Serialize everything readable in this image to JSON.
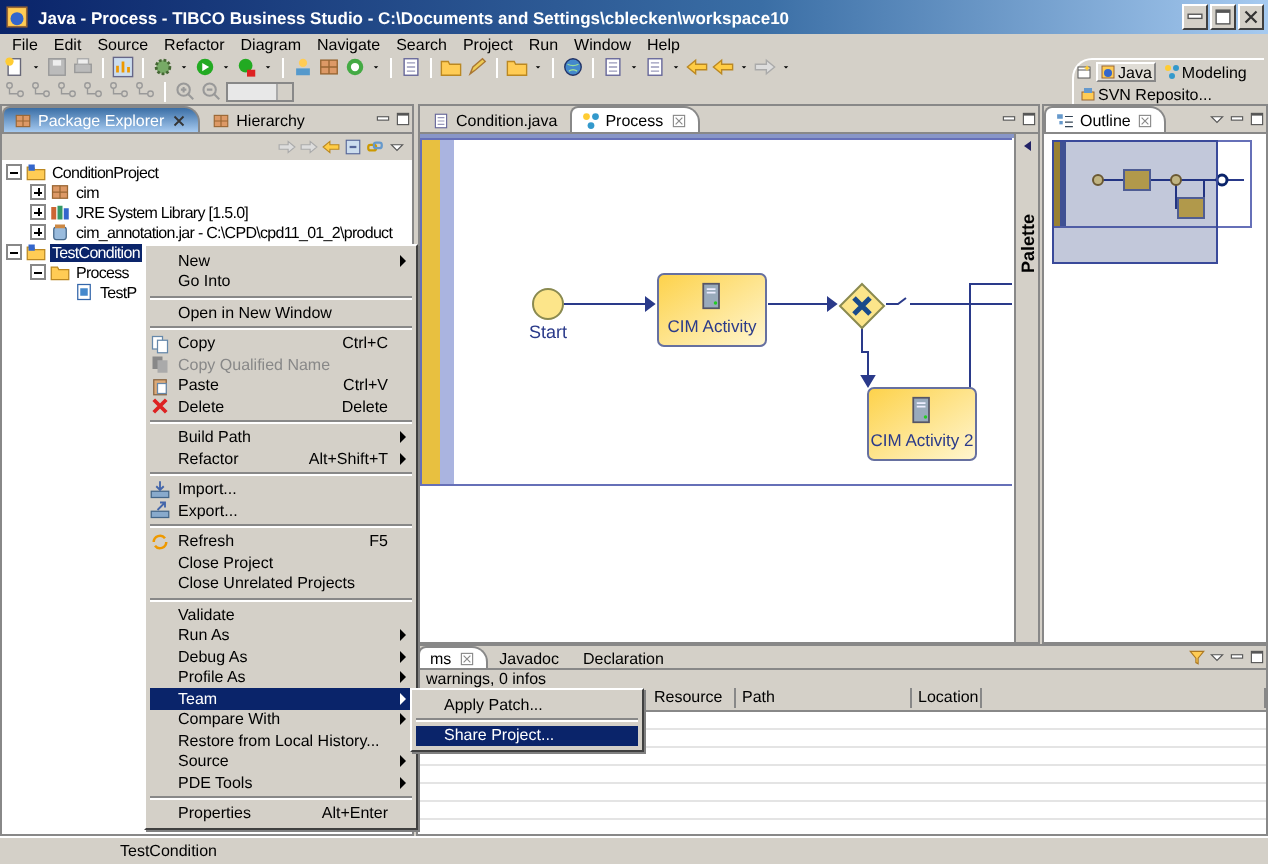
{
  "window": {
    "title": "Java - Process - TIBCO Business Studio - C:\\Documents and Settings\\cblecken\\workspace10"
  },
  "menu_bar": [
    "File",
    "Edit",
    "Source",
    "Refactor",
    "Diagram",
    "Navigate",
    "Search",
    "Project",
    "Run",
    "Window",
    "Help"
  ],
  "perspectives": [
    {
      "label": "Java",
      "selected": true
    },
    {
      "label": "Modeling",
      "selected": false
    },
    {
      "label": "SVN Reposito...",
      "selected": false
    }
  ],
  "package_explorer": {
    "tabs": [
      {
        "label": "Package Explorer",
        "selected": true
      },
      {
        "label": "Hierarchy",
        "selected": false
      }
    ],
    "tree": [
      {
        "kind": "project",
        "label": "ConditionProject",
        "expanded": true,
        "selected": false,
        "children": [
          {
            "kind": "package",
            "label": "cim",
            "expanded": false,
            "selected": false
          },
          {
            "kind": "library",
            "label": "JRE System Library [1.5.0]",
            "expanded": false,
            "selected": false
          },
          {
            "kind": "jar",
            "label": "cim_annotation.jar - C:\\CPD\\cpd11_01_2\\product",
            "expanded": false,
            "selected": false
          }
        ]
      },
      {
        "kind": "project",
        "label": "TestCondition",
        "expanded": true,
        "selected": true,
        "children": [
          {
            "kind": "folder",
            "label": "Process",
            "expanded": true,
            "selected": false,
            "children": [
              {
                "kind": "process",
                "label": "TestP",
                "selected": false
              }
            ]
          }
        ]
      }
    ]
  },
  "editor": {
    "tabs": [
      {
        "label": "Condition.java",
        "selected": false
      },
      {
        "label": "Process",
        "selected": true
      }
    ],
    "palette_label": "Palette",
    "diagram": {
      "nodes": [
        {
          "kind": "start",
          "label": "Start"
        },
        {
          "kind": "activity",
          "label": "CIM Activity"
        },
        {
          "kind": "gateway"
        },
        {
          "kind": "activity",
          "label": "CIM Activity 2"
        }
      ]
    }
  },
  "outline": {
    "tab": "Outline"
  },
  "problems": {
    "tabs": [
      {
        "label": "ms",
        "selected": true
      },
      {
        "label": "Javadoc",
        "selected": false
      },
      {
        "label": "Declaration",
        "selected": false
      }
    ],
    "summary": "warnings, 0 infos",
    "columns": [
      "Resource",
      "Path",
      "Location"
    ]
  },
  "context_menu": {
    "items": [
      {
        "kind": "item",
        "label": "New",
        "has_submenu": true,
        "disabled": false,
        "selected": false
      },
      {
        "kind": "item",
        "label": "Go Into",
        "has_submenu": false,
        "disabled": false,
        "selected": false
      },
      {
        "kind": "separator"
      },
      {
        "kind": "item",
        "label": "Open in New Window",
        "has_submenu": false,
        "disabled": false,
        "selected": false
      },
      {
        "kind": "separator"
      },
      {
        "kind": "item",
        "label": "Copy",
        "shortcut": "Ctrl+C",
        "has_submenu": false,
        "disabled": false,
        "selected": false
      },
      {
        "kind": "item",
        "label": "Copy Qualified Name",
        "has_submenu": false,
        "disabled": true,
        "selected": false
      },
      {
        "kind": "item",
        "label": "Paste",
        "shortcut": "Ctrl+V",
        "has_submenu": false,
        "disabled": false,
        "selected": false
      },
      {
        "kind": "item",
        "label": "Delete",
        "shortcut": "Delete",
        "has_submenu": false,
        "disabled": false,
        "selected": false
      },
      {
        "kind": "separator"
      },
      {
        "kind": "item",
        "label": "Build Path",
        "has_submenu": true,
        "disabled": false,
        "selected": false
      },
      {
        "kind": "item",
        "label": "Refactor",
        "shortcut": "Alt+Shift+T",
        "has_submenu": true,
        "disabled": false,
        "selected": false
      },
      {
        "kind": "separator"
      },
      {
        "kind": "item",
        "label": "Import...",
        "has_submenu": false,
        "disabled": false,
        "selected": false
      },
      {
        "kind": "item",
        "label": "Export...",
        "has_submenu": false,
        "disabled": false,
        "selected": false
      },
      {
        "kind": "separator"
      },
      {
        "kind": "item",
        "label": "Refresh",
        "shortcut": "F5",
        "has_submenu": false,
        "disabled": false,
        "selected": false
      },
      {
        "kind": "item",
        "label": "Close Project",
        "has_submenu": false,
        "disabled": false,
        "selected": false
      },
      {
        "kind": "item",
        "label": "Close Unrelated Projects",
        "has_submenu": false,
        "disabled": false,
        "selected": false
      },
      {
        "kind": "separator"
      },
      {
        "kind": "item",
        "label": "Validate",
        "has_submenu": false,
        "disabled": false,
        "selected": false
      },
      {
        "kind": "item",
        "label": "Run As",
        "has_submenu": true,
        "disabled": false,
        "selected": false
      },
      {
        "kind": "item",
        "label": "Debug As",
        "has_submenu": true,
        "disabled": false,
        "selected": false
      },
      {
        "kind": "item",
        "label": "Profile As",
        "has_submenu": true,
        "disabled": false,
        "selected": false
      },
      {
        "kind": "item",
        "label": "Team",
        "has_submenu": true,
        "disabled": false,
        "selected": true
      },
      {
        "kind": "item",
        "label": "Compare With",
        "has_submenu": true,
        "disabled": false,
        "selected": false
      },
      {
        "kind": "item",
        "label": "Restore from Local History...",
        "has_submenu": false,
        "disabled": false,
        "selected": false
      },
      {
        "kind": "item",
        "label": "Source",
        "has_submenu": true,
        "disabled": false,
        "selected": false
      },
      {
        "kind": "item",
        "label": "PDE Tools",
        "has_submenu": true,
        "disabled": false,
        "selected": false
      },
      {
        "kind": "separator"
      },
      {
        "kind": "item",
        "label": "Properties",
        "shortcut": "Alt+Enter",
        "has_submenu": false,
        "disabled": false,
        "selected": false
      }
    ]
  },
  "team_submenu": {
    "items": [
      {
        "kind": "item",
        "label": "Apply Patch...",
        "has_submenu": false,
        "disabled": false,
        "selected": false
      },
      {
        "kind": "separator"
      },
      {
        "kind": "item",
        "label": "Share Project...",
        "has_submenu": false,
        "disabled": false,
        "selected": true
      }
    ]
  },
  "status_bar": {
    "text": "TestCondition"
  }
}
